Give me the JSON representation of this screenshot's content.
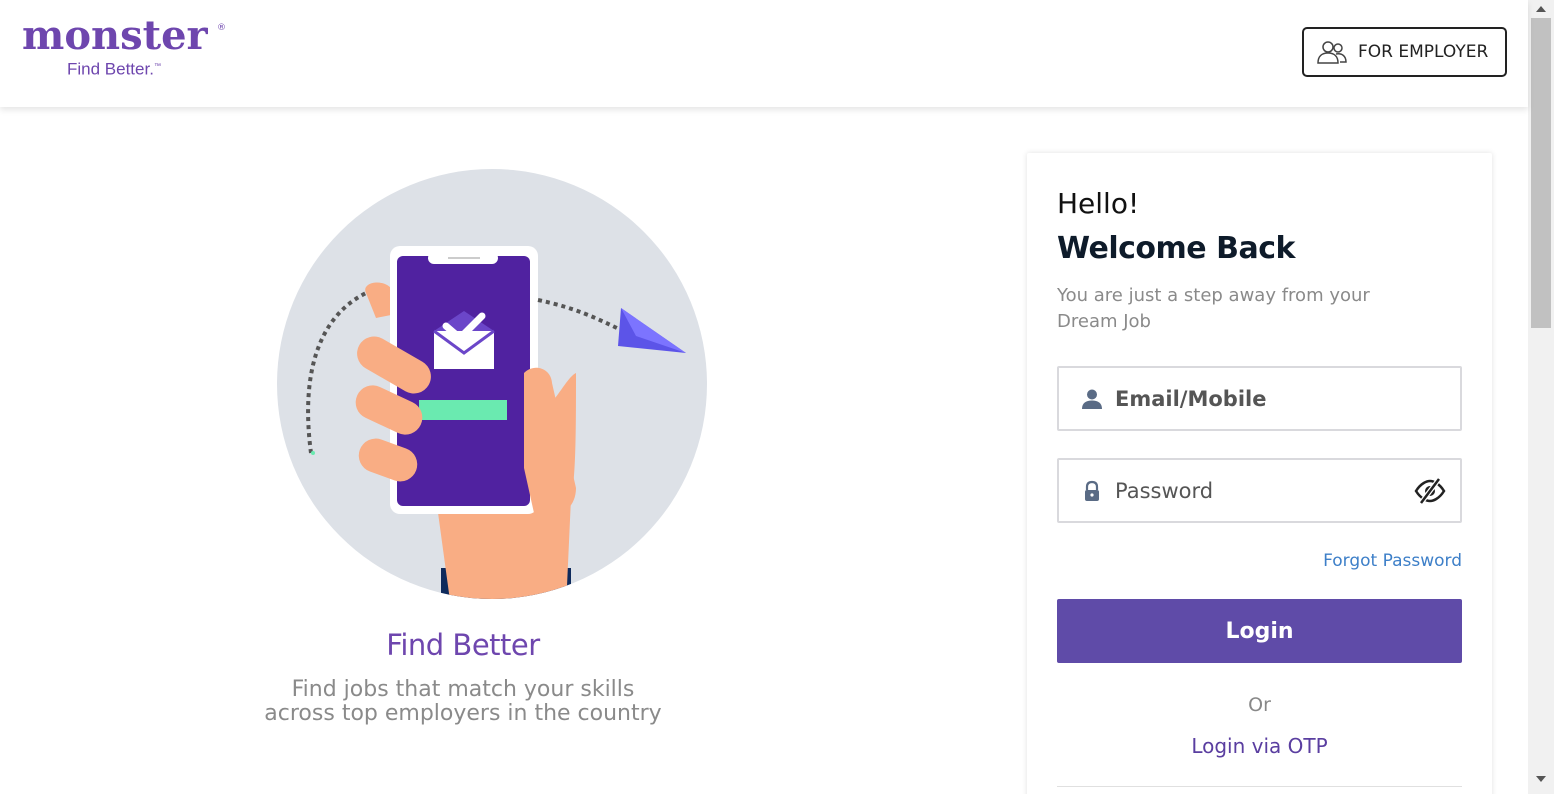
{
  "header": {
    "logo_word": "monster",
    "logo_reg": "®",
    "logo_tagline": "Find Better.",
    "logo_tm": "™",
    "employer_button": "FOR EMPLOYER",
    "employer_icon": "users-icon"
  },
  "hero": {
    "title": "Find Better",
    "subtitle": "Find jobs that match your skills across top employers in the country",
    "illustration_icon": "phone-hand-illustration"
  },
  "login": {
    "greeting": "Hello!",
    "heading": "Welcome Back",
    "tagline": "You are just a step away from your Dream Job",
    "email_placeholder": "Email/Mobile",
    "password_placeholder": "Password",
    "email_icon": "user-icon",
    "password_icon": "lock-icon",
    "toggle_icon": "eye-slash-icon",
    "forgot_link": "Forgot Password",
    "login_button": "Login",
    "or_text": "Or",
    "otp_link": "Login via OTP"
  },
  "colors": {
    "brand": "#6e46ae",
    "button": "#5f4ba8",
    "link": "#3d7fc8",
    "phone_screen": "#5022a0",
    "accent_green": "#6aeab0"
  }
}
